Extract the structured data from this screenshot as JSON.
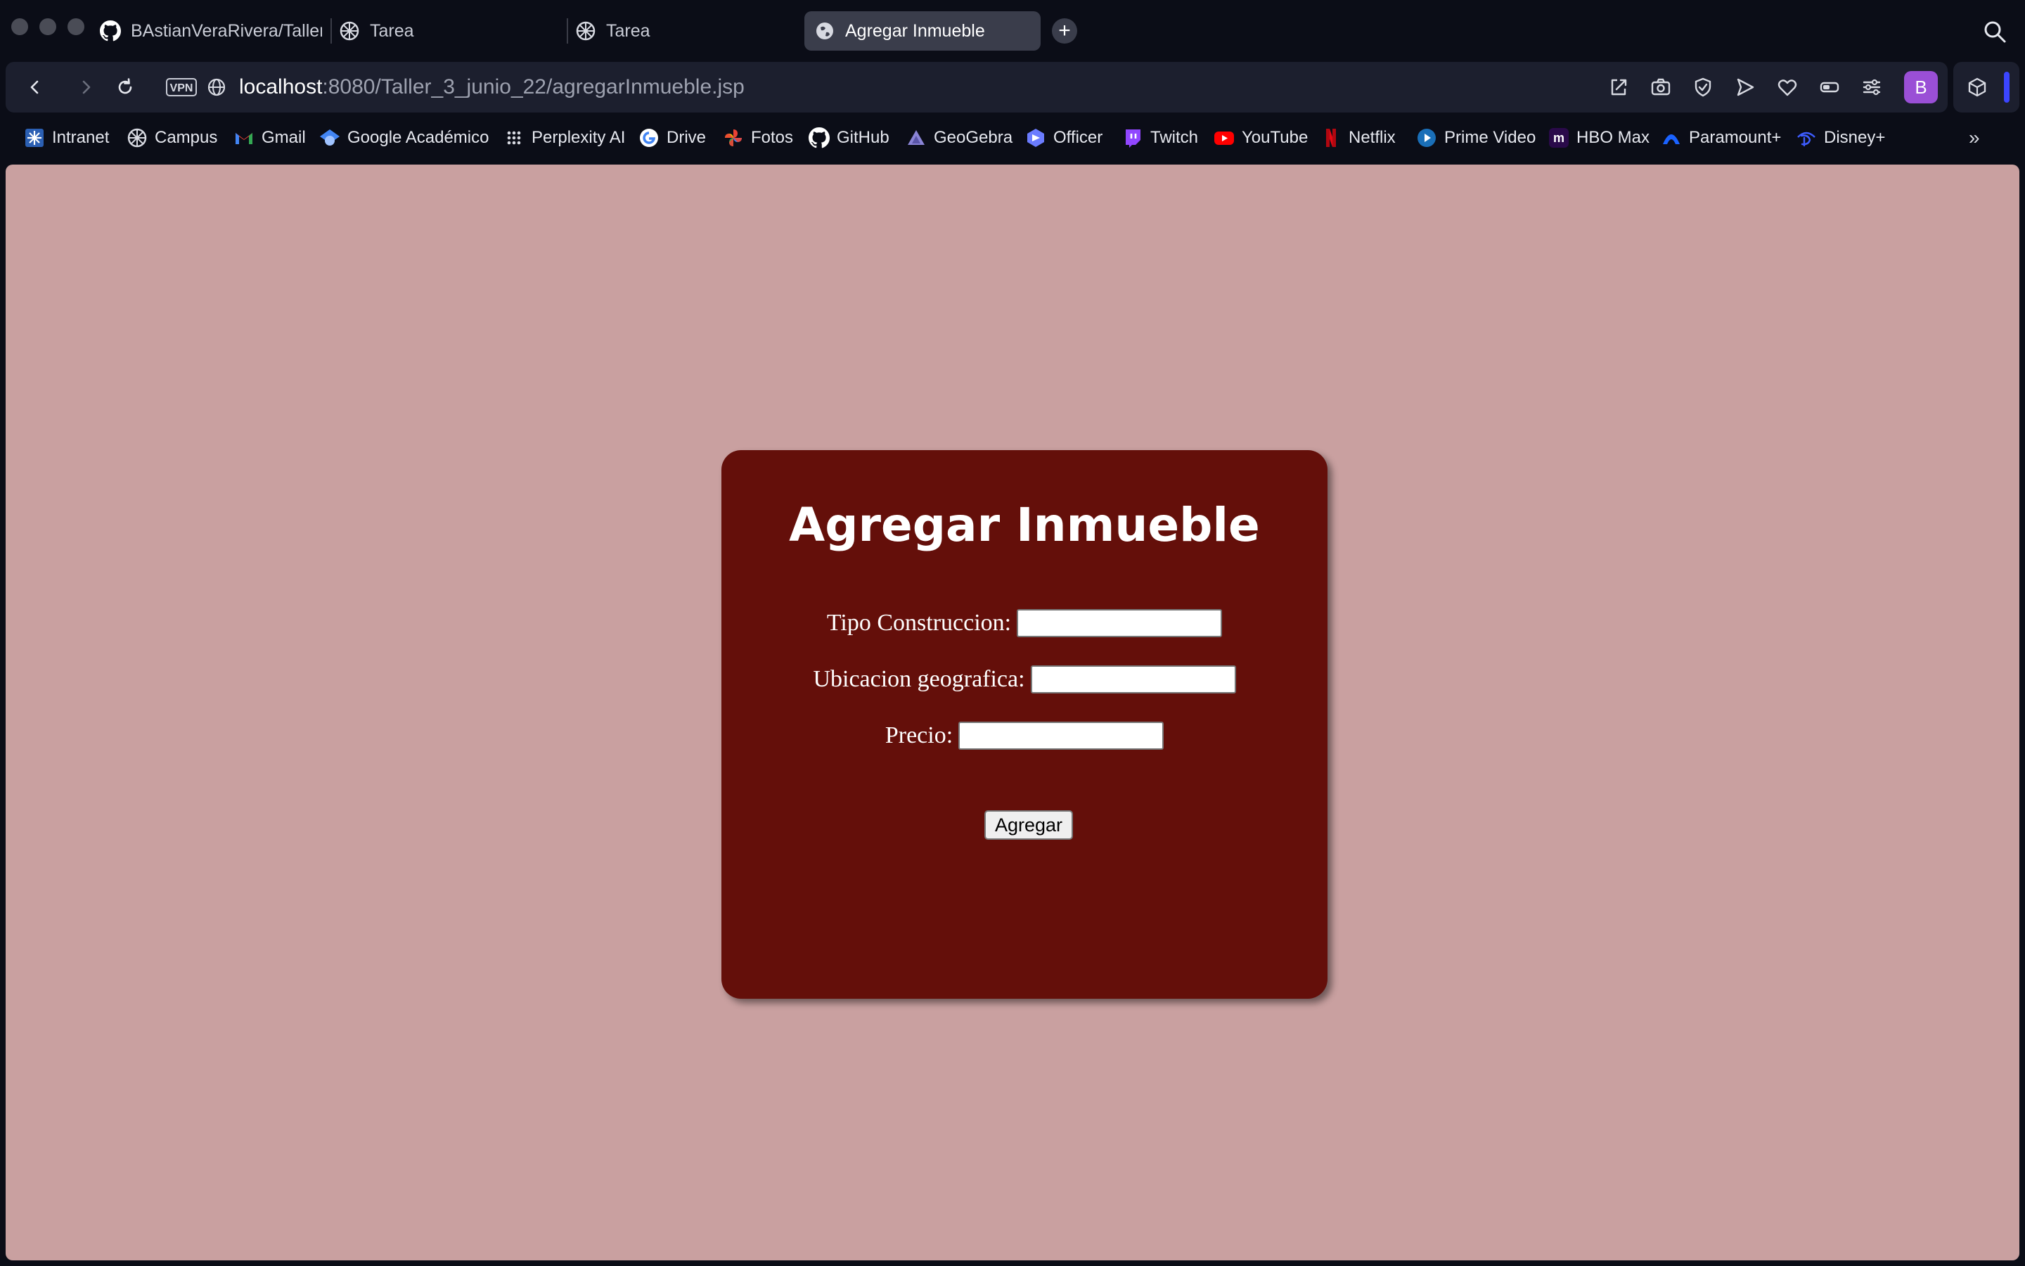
{
  "browser": {
    "tabs": [
      {
        "title": "BAstianVeraRivera/Taller",
        "icon": "github-icon",
        "active": false
      },
      {
        "title": "Tarea",
        "icon": "campus-icon",
        "active": false
      },
      {
        "title": "Tarea",
        "icon": "campus-icon",
        "active": false
      },
      {
        "title": "Agregar Inmueble",
        "icon": "globe-icon",
        "active": true
      }
    ],
    "new_tab": "+",
    "address": {
      "vpn": "VPN",
      "host": "localhost",
      "path": ":8080/Taller_3_junio_22/agregarInmueble.jsp"
    },
    "profile_initial": "B",
    "bookmarks": [
      {
        "label": "Intranet",
        "icon": "intranet-icon"
      },
      {
        "label": "Campus",
        "icon": "campus-icon"
      },
      {
        "label": "Gmail",
        "icon": "gmail-icon"
      },
      {
        "label": "Google Académico",
        "icon": "scholar-icon"
      },
      {
        "label": "Perplexity AI",
        "icon": "grid-icon"
      },
      {
        "label": "Drive",
        "icon": "google-icon"
      },
      {
        "label": "Fotos",
        "icon": "photos-icon"
      },
      {
        "label": "GitHub",
        "icon": "github-icon"
      },
      {
        "label": "GeoGebra",
        "icon": "geogebra-icon"
      },
      {
        "label": "Officer",
        "icon": "officer-icon"
      },
      {
        "label": "Twitch",
        "icon": "twitch-icon"
      },
      {
        "label": "YouTube",
        "icon": "youtube-icon"
      },
      {
        "label": "Netflix",
        "icon": "netflix-icon"
      },
      {
        "label": "Prime Video",
        "icon": "prime-video-icon"
      },
      {
        "label": "HBO Max",
        "icon": "hbo-max-icon"
      },
      {
        "label": "Paramount+",
        "icon": "paramount-icon"
      },
      {
        "label": "Disney+",
        "icon": "disney-icon"
      }
    ],
    "bookmarks_overflow": "»"
  },
  "page": {
    "title": "Agregar Inmueble",
    "fields": [
      {
        "label": "Tipo Construccion:",
        "value": ""
      },
      {
        "label": "Ubicacion geografica:",
        "value": ""
      },
      {
        "label": "Precio:",
        "value": ""
      }
    ],
    "submit_label": "Agregar"
  },
  "colors": {
    "page_background": "#c9a0a0",
    "card_background": "#640f0a",
    "browser_chrome": "#0b0d17"
  }
}
